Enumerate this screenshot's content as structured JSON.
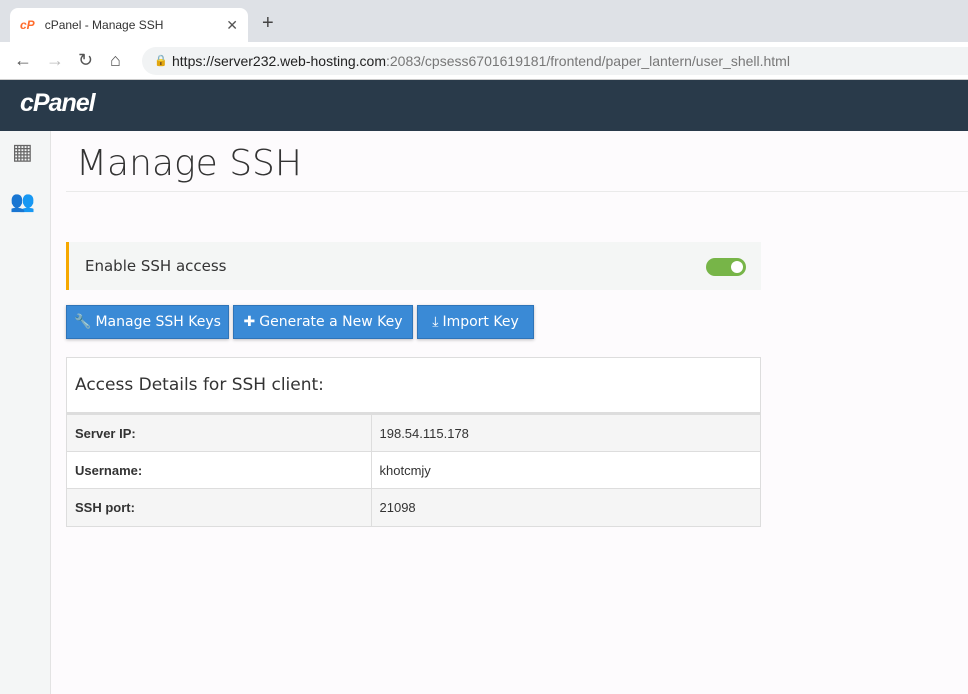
{
  "browser": {
    "tab_title": "cPanel - Manage SSH",
    "url_host": "https://server232.web-hosting.com",
    "url_rest": ":2083/cpsess6701619181/frontend/paper_lantern/user_shell.html"
  },
  "header": {
    "logo": "cPanel"
  },
  "page": {
    "title": "Manage SSH"
  },
  "ssh_toggle": {
    "label": "Enable SSH access",
    "enabled": true
  },
  "buttons": {
    "manage": "Manage SSH Keys",
    "generate": "Generate a New Key",
    "import": "Import Key"
  },
  "access": {
    "title": "Access Details for SSH client:",
    "rows": [
      {
        "label": "Server IP:",
        "value": "198.54.115.178"
      },
      {
        "label": "Username:",
        "value": "khotcmjy"
      },
      {
        "label": "SSH port:",
        "value": "21098"
      }
    ]
  }
}
